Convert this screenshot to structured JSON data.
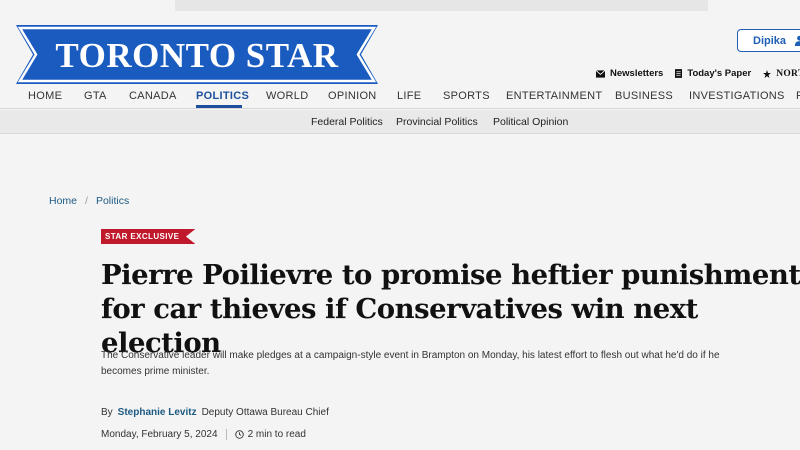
{
  "brand": {
    "logo_text": "TORONTO STAR",
    "logo_color": "#1a5bbf"
  },
  "user": {
    "name": "Dipika"
  },
  "utility": {
    "newsletters": "Newsletters",
    "todays_paper": "Today's Paper",
    "northstar": "NORTHST"
  },
  "nav": {
    "items": [
      "HOME",
      "GTA",
      "CANADA",
      "POLITICS",
      "WORLD",
      "OPINION",
      "LIFE",
      "SPORTS",
      "ENTERTAINMENT",
      "BUSINESS",
      "INVESTIGATIONS",
      "F"
    ],
    "active": "POLITICS"
  },
  "subnav": {
    "items": [
      "Federal Politics",
      "Provincial Politics",
      "Political Opinion"
    ]
  },
  "breadcrumb": {
    "home": "Home",
    "separator": "/",
    "section": "Politics"
  },
  "article": {
    "tag": "STAR EXCLUSIVE",
    "tag_color": "#c0192c",
    "headline": "Pierre Poilievre to promise heftier punishment for car thieves if Conservatives win next election",
    "dek": "The Conservative leader will make pledges at a campaign-style event in Brampton on Monday, his latest effort to flesh out what he'd do if he becomes prime minister.",
    "by": "By",
    "author": "Stephanie Levitz",
    "author_title": "Deputy Ottawa Bureau Chief",
    "date": "Monday, February 5, 2024",
    "read_time": "2 min to read"
  },
  "icons": {
    "user": "user-icon",
    "newsletters": "envelope-icon",
    "todays_paper": "newspaper-icon",
    "northstar": "star-icon",
    "read_time": "clock-icon"
  }
}
